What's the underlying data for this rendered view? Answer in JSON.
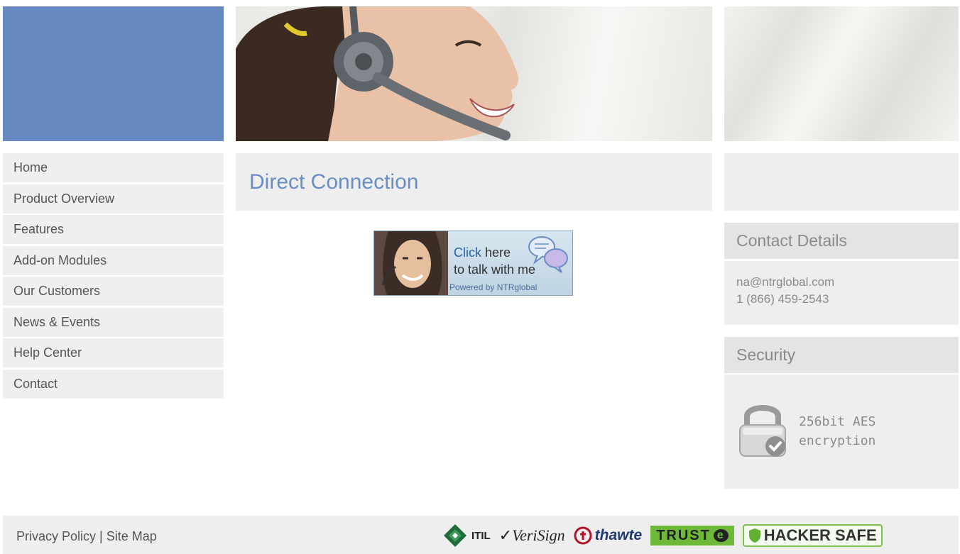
{
  "nav": {
    "items": [
      {
        "label": "Home"
      },
      {
        "label": "Product Overview"
      },
      {
        "label": "Features"
      },
      {
        "label": "Add-on Modules"
      },
      {
        "label": "Our Customers"
      },
      {
        "label": "News & Events"
      },
      {
        "label": "Help Center"
      },
      {
        "label": "Contact"
      }
    ]
  },
  "main": {
    "title": "Direct Connection",
    "chat_widget": {
      "click_word": "Click",
      "line1_rest": " here",
      "line2": "to talk with me",
      "powered_by": "Powered by NTRglobal"
    }
  },
  "sidebar": {
    "contact": {
      "heading": "Contact Details",
      "email": "na@ntrglobal.com",
      "phone": "1 (866) 459-2543"
    },
    "security": {
      "heading": "Security",
      "line1": "256bit AES",
      "line2": "encryption"
    }
  },
  "footer": {
    "privacy_label": "Privacy Policy",
    "separator": " | ",
    "sitemap_label": "Site Map",
    "badges": {
      "itil": "ITIL",
      "verisign": "VeriSign",
      "thawte": "thawte",
      "truste": "TRUST",
      "truste_mark": "e",
      "hacker_safe": "HACKER SAFE"
    }
  },
  "colors": {
    "brand_blue": "#6688c0",
    "title_blue": "#6a8ec3",
    "panel_gray": "#eeeeee"
  }
}
